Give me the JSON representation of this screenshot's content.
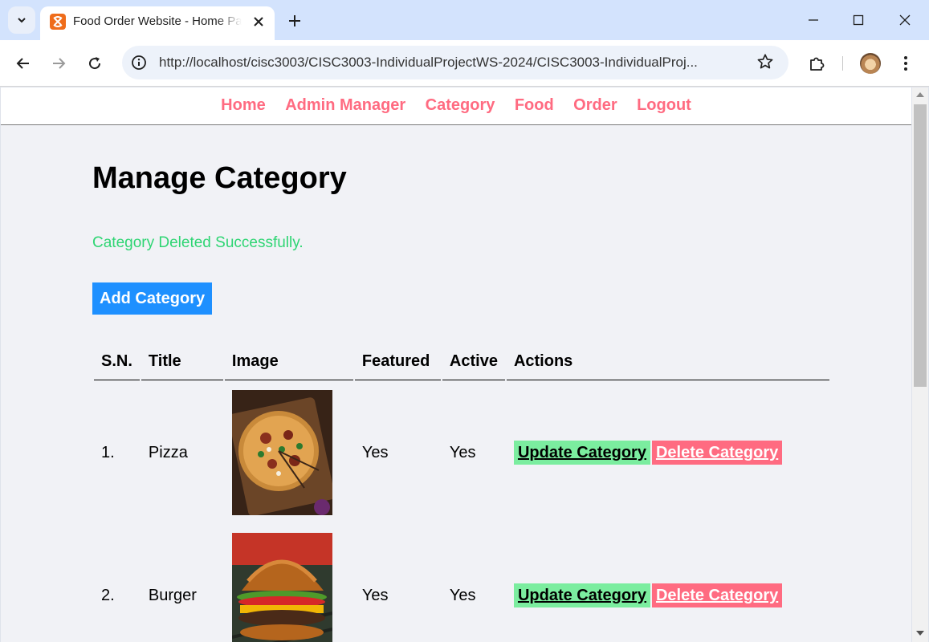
{
  "browser": {
    "tab_title": "Food Order Website - Home Page",
    "url": "http://localhost/cisc3003/CISC3003-IndividualProjectWS-2024/CISC3003-IndividualProj..."
  },
  "nav": {
    "items": [
      "Home",
      "Admin Manager",
      "Category",
      "Food",
      "Order",
      "Logout"
    ]
  },
  "page": {
    "title": "Manage Category",
    "message": "Category Deleted Successfully.",
    "add_button": "Add Category"
  },
  "table": {
    "headers": [
      "S.N.",
      "Title",
      "Image",
      "Featured",
      "Active",
      "Actions"
    ],
    "rows": [
      {
        "sn": "1.",
        "title": "Pizza",
        "image_icon": "pizza-image",
        "featured": "Yes",
        "active": "Yes",
        "update_label": "Update Category",
        "delete_label": "Delete Category"
      },
      {
        "sn": "2.",
        "title": "Burger",
        "image_icon": "burger-image",
        "featured": "Yes",
        "active": "Yes",
        "update_label": "Update Category",
        "delete_label": "Delete Category"
      }
    ]
  },
  "colors": {
    "nav_link": "#ff6b81",
    "success": "#2ed573",
    "add_button": "#1e90ff",
    "update_button": "#7bed9f",
    "delete_button": "#ff6b81",
    "page_background": "#f1f2f6"
  }
}
